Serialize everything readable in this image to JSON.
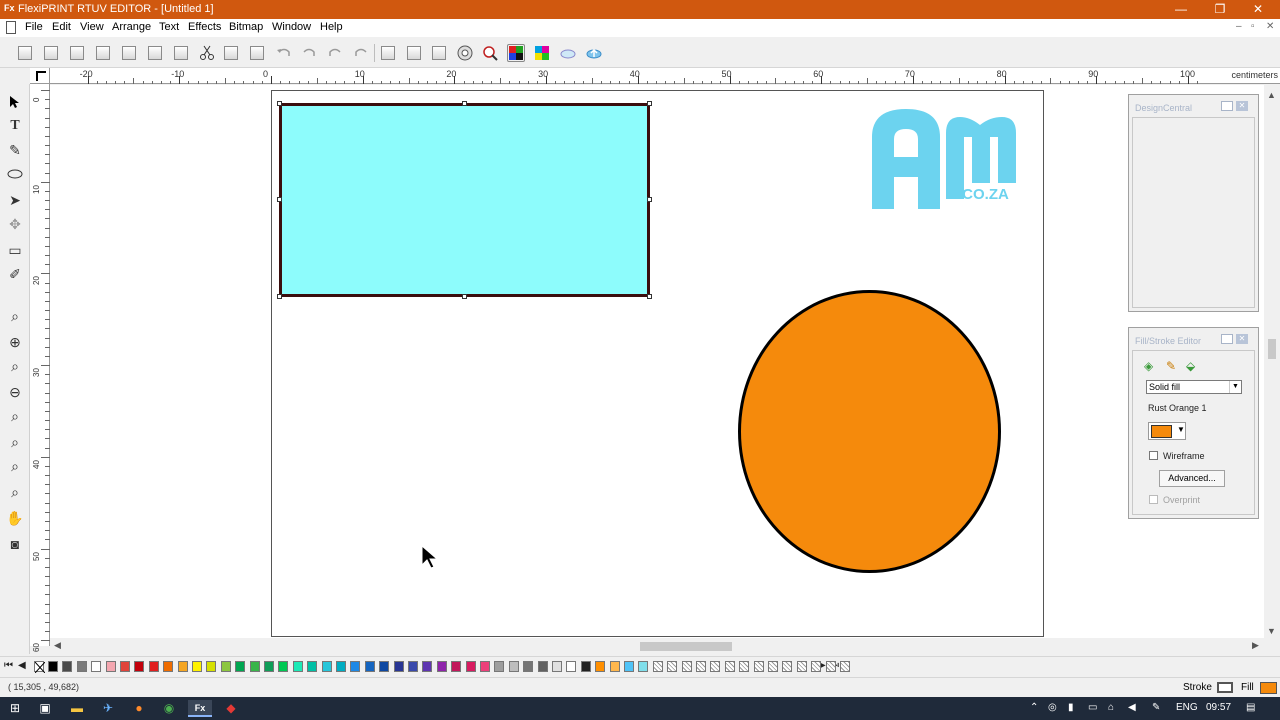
{
  "window": {
    "app_icon": "Fx",
    "title": "FlexiPRINT RTUV EDITOR - [Untitled 1]",
    "minimize": "—",
    "maximize": "❐",
    "close": "✕"
  },
  "menu": {
    "items": [
      "File",
      "Edit",
      "View",
      "Arrange",
      "Text",
      "Effects",
      "Bitmap",
      "Window",
      "Help"
    ],
    "mdi": [
      "–",
      "▫",
      "✕"
    ]
  },
  "toolbar": {
    "icons": [
      "new-icon",
      "open-icon",
      "save-icon",
      "save-as-icon",
      "print-setup-icon",
      "print-icon",
      "plot-icon",
      "cut-icon",
      "copy-icon",
      "paste-icon",
      "undo-icon",
      "redo-icon",
      "redo2-icon",
      "redo3-icon",
      "group-icon",
      "ungroup-icon",
      "arrange-icon",
      "color-wheel-icon",
      "zoom-icon",
      "color-bars-icon",
      "color-palette-icon",
      "cloud-icon",
      "cloud-upload-icon"
    ]
  },
  "ruler": {
    "units": "centimeters",
    "h_labels": [
      "-20",
      "-10",
      "0",
      "10",
      "20",
      "30",
      "40",
      "50",
      "60",
      "70",
      "80",
      "90",
      "100"
    ],
    "v_labels": [
      "0",
      "10",
      "20",
      "30",
      "40",
      "50",
      "60"
    ]
  },
  "tools": {
    "items": [
      "select-arrow",
      "text",
      "shape-edit",
      "ellipse",
      "arrow-tool",
      "grey-tool",
      "ruler-tool",
      "eyedropper",
      "zoom-lens",
      "zoom-in",
      "zoom-fit",
      "zoom-out",
      "zoom-page",
      "zoom-all",
      "zoom-sel",
      "zoom-actual",
      "pan-hand",
      "fill-tool"
    ]
  },
  "canvas": {
    "logo_text": "Am",
    "logo_sub": ".CO.ZA",
    "colors": {
      "rect_fill": "#8dfcfc",
      "rect_stroke": "#3b0d0d",
      "circle_fill": "#f58a0c",
      "logo": "#6cd3ef"
    }
  },
  "dockers": {
    "design_central": {
      "title": "DesignCentral"
    },
    "fill_stroke": {
      "title": "Fill/Stroke Editor",
      "fill_type": "Solid fill",
      "color_name": "Rust Orange 1",
      "wireframe_label": "Wireframe",
      "advanced_label": "Advanced...",
      "overprint_label": "Overprint"
    }
  },
  "palette": {
    "colors": [
      "#000000",
      "#4a4a4a",
      "#7a7a7a",
      "#ffffff",
      "#f4a7b0",
      "#e0433a",
      "#c2000b",
      "#e01f1f",
      "#ef6c00",
      "#f5a623",
      "#fff200",
      "#d6e000",
      "#8cc63f",
      "#00a651",
      "#39b54a",
      "#0f9d58",
      "#00c853",
      "#1de9b6",
      "#00bfa5",
      "#26c6da",
      "#00acc1",
      "#1e88e5",
      "#1565c0",
      "#0d47a1",
      "#283593",
      "#3949ab",
      "#5e35b1",
      "#8e24aa",
      "#c2185b",
      "#d81b60",
      "#ec407a",
      "#9e9e9e",
      "#bdbdbd",
      "#757575",
      "#616161",
      "#e0e0e0",
      "#ffffff",
      "#212121",
      "#ff8f00",
      "#ffb74d",
      "#4fc3f7",
      "#80deea"
    ]
  },
  "status": {
    "coords": "( 15,305 ,  49,682)",
    "stroke_label": "Stroke",
    "fill_label": "Fill",
    "fill_color": "#f58a0c"
  },
  "taskbar": {
    "lang": "ENG",
    "time": "09:57"
  }
}
